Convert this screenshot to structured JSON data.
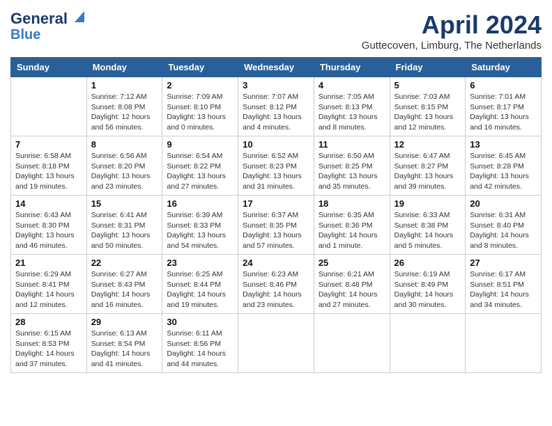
{
  "logo": {
    "line1": "General",
    "line2": "Blue"
  },
  "title": "April 2024",
  "subtitle": "Guttecoven, Limburg, The Netherlands",
  "days": [
    "Sunday",
    "Monday",
    "Tuesday",
    "Wednesday",
    "Thursday",
    "Friday",
    "Saturday"
  ],
  "weeks": [
    [
      {
        "day": "",
        "info": ""
      },
      {
        "day": "1",
        "sunrise": "Sunrise: 7:12 AM",
        "sunset": "Sunset: 8:08 PM",
        "daylight": "Daylight: 12 hours and 56 minutes."
      },
      {
        "day": "2",
        "sunrise": "Sunrise: 7:09 AM",
        "sunset": "Sunset: 8:10 PM",
        "daylight": "Daylight: 13 hours and 0 minutes."
      },
      {
        "day": "3",
        "sunrise": "Sunrise: 7:07 AM",
        "sunset": "Sunset: 8:12 PM",
        "daylight": "Daylight: 13 hours and 4 minutes."
      },
      {
        "day": "4",
        "sunrise": "Sunrise: 7:05 AM",
        "sunset": "Sunset: 8:13 PM",
        "daylight": "Daylight: 13 hours and 8 minutes."
      },
      {
        "day": "5",
        "sunrise": "Sunrise: 7:03 AM",
        "sunset": "Sunset: 8:15 PM",
        "daylight": "Daylight: 13 hours and 12 minutes."
      },
      {
        "day": "6",
        "sunrise": "Sunrise: 7:01 AM",
        "sunset": "Sunset: 8:17 PM",
        "daylight": "Daylight: 13 hours and 16 minutes."
      }
    ],
    [
      {
        "day": "7",
        "sunrise": "Sunrise: 6:58 AM",
        "sunset": "Sunset: 8:18 PM",
        "daylight": "Daylight: 13 hours and 19 minutes."
      },
      {
        "day": "8",
        "sunrise": "Sunrise: 6:56 AM",
        "sunset": "Sunset: 8:20 PM",
        "daylight": "Daylight: 13 hours and 23 minutes."
      },
      {
        "day": "9",
        "sunrise": "Sunrise: 6:54 AM",
        "sunset": "Sunset: 8:22 PM",
        "daylight": "Daylight: 13 hours and 27 minutes."
      },
      {
        "day": "10",
        "sunrise": "Sunrise: 6:52 AM",
        "sunset": "Sunset: 8:23 PM",
        "daylight": "Daylight: 13 hours and 31 minutes."
      },
      {
        "day": "11",
        "sunrise": "Sunrise: 6:50 AM",
        "sunset": "Sunset: 8:25 PM",
        "daylight": "Daylight: 13 hours and 35 minutes."
      },
      {
        "day": "12",
        "sunrise": "Sunrise: 6:47 AM",
        "sunset": "Sunset: 8:27 PM",
        "daylight": "Daylight: 13 hours and 39 minutes."
      },
      {
        "day": "13",
        "sunrise": "Sunrise: 6:45 AM",
        "sunset": "Sunset: 8:28 PM",
        "daylight": "Daylight: 13 hours and 42 minutes."
      }
    ],
    [
      {
        "day": "14",
        "sunrise": "Sunrise: 6:43 AM",
        "sunset": "Sunset: 8:30 PM",
        "daylight": "Daylight: 13 hours and 46 minutes."
      },
      {
        "day": "15",
        "sunrise": "Sunrise: 6:41 AM",
        "sunset": "Sunset: 8:31 PM",
        "daylight": "Daylight: 13 hours and 50 minutes."
      },
      {
        "day": "16",
        "sunrise": "Sunrise: 6:39 AM",
        "sunset": "Sunset: 8:33 PM",
        "daylight": "Daylight: 13 hours and 54 minutes."
      },
      {
        "day": "17",
        "sunrise": "Sunrise: 6:37 AM",
        "sunset": "Sunset: 8:35 PM",
        "daylight": "Daylight: 13 hours and 57 minutes."
      },
      {
        "day": "18",
        "sunrise": "Sunrise: 6:35 AM",
        "sunset": "Sunset: 8:36 PM",
        "daylight": "Daylight: 14 hours and 1 minute."
      },
      {
        "day": "19",
        "sunrise": "Sunrise: 6:33 AM",
        "sunset": "Sunset: 8:38 PM",
        "daylight": "Daylight: 14 hours and 5 minutes."
      },
      {
        "day": "20",
        "sunrise": "Sunrise: 6:31 AM",
        "sunset": "Sunset: 8:40 PM",
        "daylight": "Daylight: 14 hours and 8 minutes."
      }
    ],
    [
      {
        "day": "21",
        "sunrise": "Sunrise: 6:29 AM",
        "sunset": "Sunset: 8:41 PM",
        "daylight": "Daylight: 14 hours and 12 minutes."
      },
      {
        "day": "22",
        "sunrise": "Sunrise: 6:27 AM",
        "sunset": "Sunset: 8:43 PM",
        "daylight": "Daylight: 14 hours and 16 minutes."
      },
      {
        "day": "23",
        "sunrise": "Sunrise: 6:25 AM",
        "sunset": "Sunset: 8:44 PM",
        "daylight": "Daylight: 14 hours and 19 minutes."
      },
      {
        "day": "24",
        "sunrise": "Sunrise: 6:23 AM",
        "sunset": "Sunset: 8:46 PM",
        "daylight": "Daylight: 14 hours and 23 minutes."
      },
      {
        "day": "25",
        "sunrise": "Sunrise: 6:21 AM",
        "sunset": "Sunset: 8:48 PM",
        "daylight": "Daylight: 14 hours and 27 minutes."
      },
      {
        "day": "26",
        "sunrise": "Sunrise: 6:19 AM",
        "sunset": "Sunset: 8:49 PM",
        "daylight": "Daylight: 14 hours and 30 minutes."
      },
      {
        "day": "27",
        "sunrise": "Sunrise: 6:17 AM",
        "sunset": "Sunset: 8:51 PM",
        "daylight": "Daylight: 14 hours and 34 minutes."
      }
    ],
    [
      {
        "day": "28",
        "sunrise": "Sunrise: 6:15 AM",
        "sunset": "Sunset: 8:53 PM",
        "daylight": "Daylight: 14 hours and 37 minutes."
      },
      {
        "day": "29",
        "sunrise": "Sunrise: 6:13 AM",
        "sunset": "Sunset: 8:54 PM",
        "daylight": "Daylight: 14 hours and 41 minutes."
      },
      {
        "day": "30",
        "sunrise": "Sunrise: 6:11 AM",
        "sunset": "Sunset: 8:56 PM",
        "daylight": "Daylight: 14 hours and 44 minutes."
      },
      {
        "day": "",
        "info": ""
      },
      {
        "day": "",
        "info": ""
      },
      {
        "day": "",
        "info": ""
      },
      {
        "day": "",
        "info": ""
      }
    ]
  ]
}
